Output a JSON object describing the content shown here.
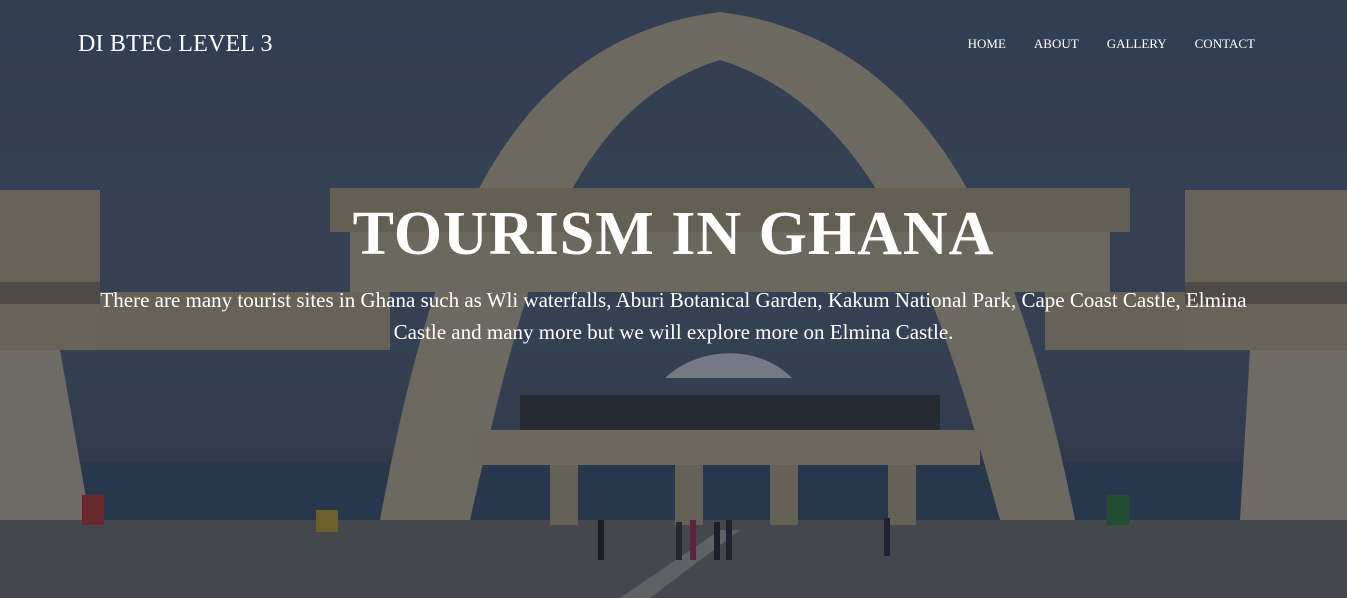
{
  "nav": {
    "brand": "DI BTEC LEVEL 3",
    "links": [
      {
        "label": "HOME"
      },
      {
        "label": "ABOUT"
      },
      {
        "label": "GALLERY"
      },
      {
        "label": "CONTACT"
      }
    ]
  },
  "hero": {
    "title": "TOURISM IN GHANA",
    "text": "There are many tourist sites in Ghana such as Wli waterfalls, Aburi Botanical Garden, Kakum National Park, Cape Coast Castle, Elmina Castle and many more but we will explore more on Elmina Castle.",
    "background_image": "independence-arch-photo"
  },
  "colors": {
    "overlay": "#161e2e",
    "text": "#ffffff"
  }
}
